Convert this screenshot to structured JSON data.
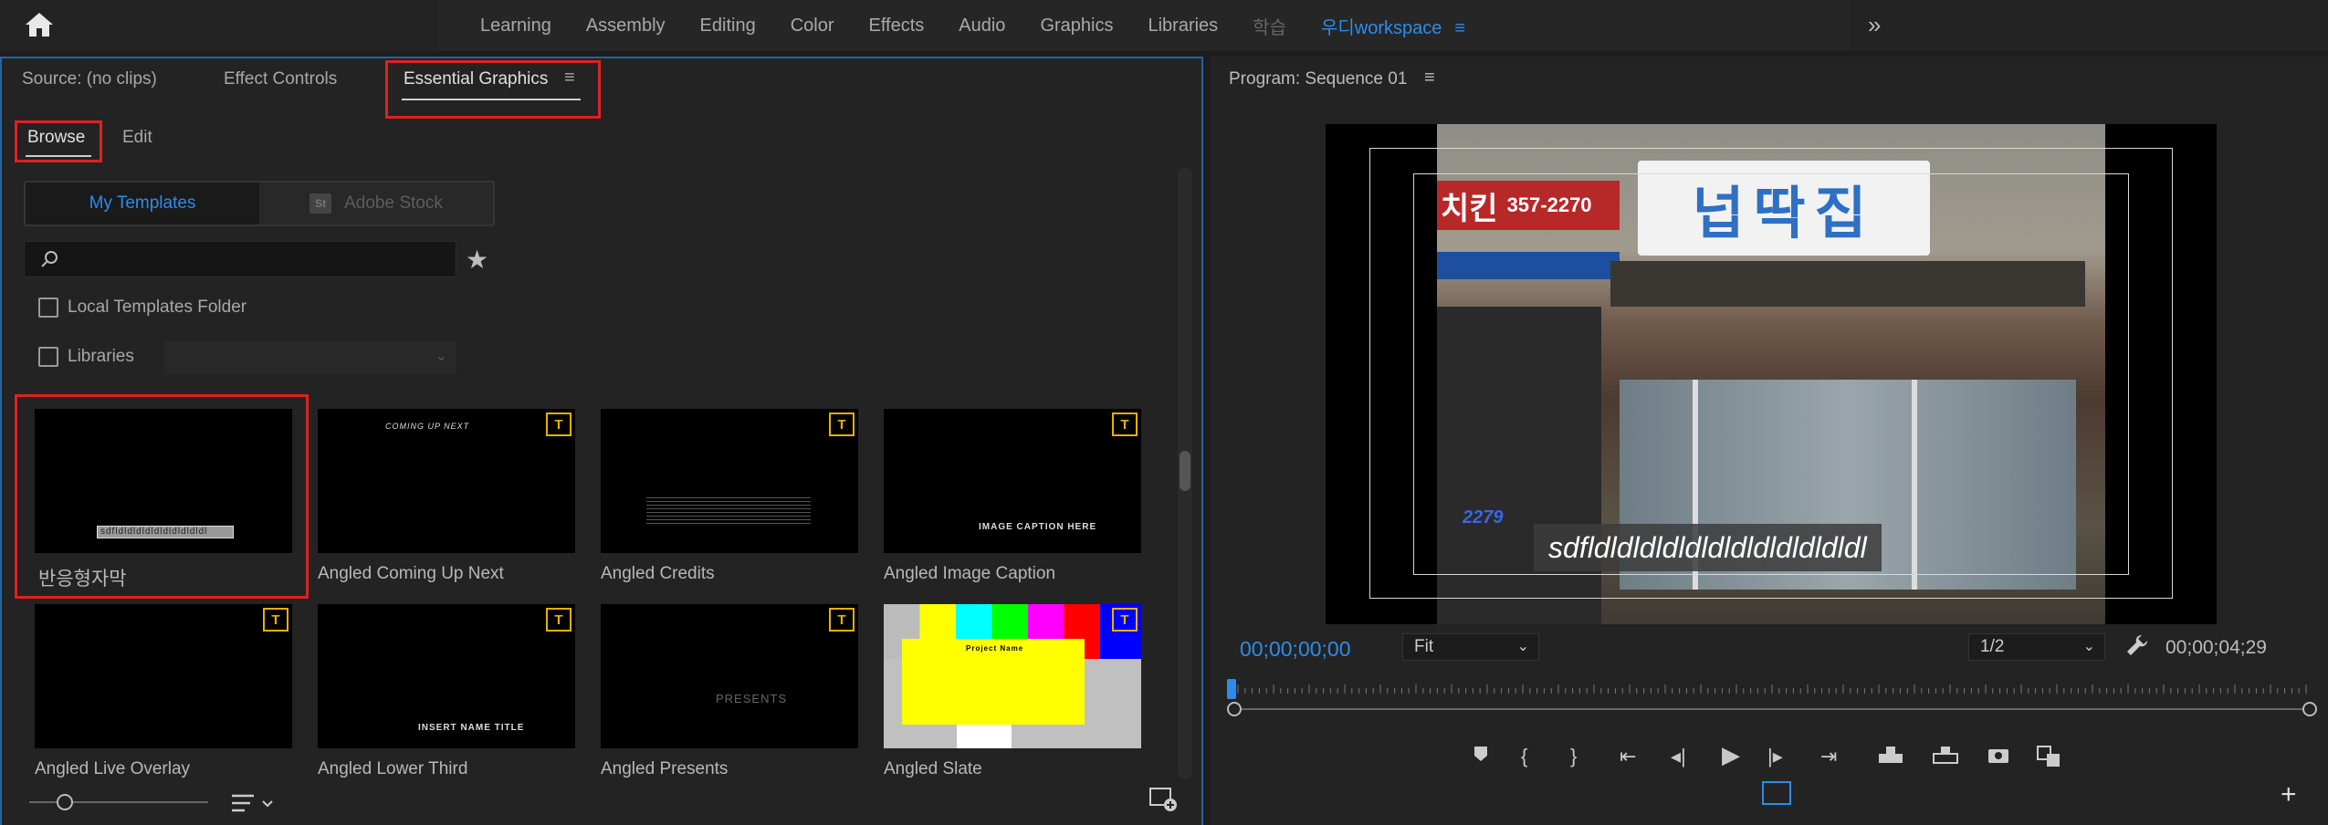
{
  "workspace": {
    "tabs": [
      "Learning",
      "Assembly",
      "Editing",
      "Color",
      "Effects",
      "Audio",
      "Graphics",
      "Libraries"
    ],
    "dim_tab": "학습",
    "active_prefix": "우디",
    "active_tab": "workspace",
    "menu_glyph": "≡",
    "more_glyph": "»"
  },
  "left_panel": {
    "tabs": {
      "source": "Source: (no clips)",
      "effect_controls": "Effect Controls",
      "essential_graphics": "Essential Graphics"
    },
    "panel_menu": "≡",
    "subtabs": {
      "browse": "Browse",
      "edit": "Edit"
    },
    "segmented": {
      "my_templates": "My Templates",
      "adobe_stock": "Adobe Stock",
      "stock_badge": "St"
    },
    "search": {
      "placeholder": ""
    },
    "checkboxes": {
      "local": "Local Templates Folder",
      "libraries": "Libraries"
    },
    "templates": [
      {
        "name": "반응형자막",
        "thumb_text": "sdfldldldldldldldldldldl",
        "badge": ""
      },
      {
        "name": "Angled Coming Up Next",
        "thumb_text": "COMING UP NEXT",
        "badge": "T"
      },
      {
        "name": "Angled Credits",
        "thumb_text": "",
        "badge": "T"
      },
      {
        "name": "Angled Image Caption",
        "thumb_text": "IMAGE CAPTION HERE",
        "badge": "T"
      },
      {
        "name": "Angled Live Overlay",
        "thumb_text": "",
        "badge": "T"
      },
      {
        "name": "Angled Lower Third",
        "thumb_text": "INSERT NAME TITLE",
        "badge": "T"
      },
      {
        "name": "Angled Presents",
        "thumb_text": "PRESENTS",
        "badge": "T"
      },
      {
        "name": "Angled Slate",
        "thumb_text": "Project Name",
        "badge": "T"
      }
    ]
  },
  "program": {
    "title": "Program: Sequence 01",
    "menu": "≡",
    "sign_main": "넙딱집",
    "sign_red_big": "치킨",
    "sign_red_num": "357-2270",
    "shop_num": "2279",
    "caption": "sdfldldldldldldldldldldldldl",
    "timecode": "00;00;00;00",
    "fit": "Fit",
    "resolution": "1/2",
    "duration": "00;00;04;29"
  },
  "colors": {
    "accent": "#2d8ceb",
    "highlight": "#e02020",
    "badge": "#e8b000"
  }
}
